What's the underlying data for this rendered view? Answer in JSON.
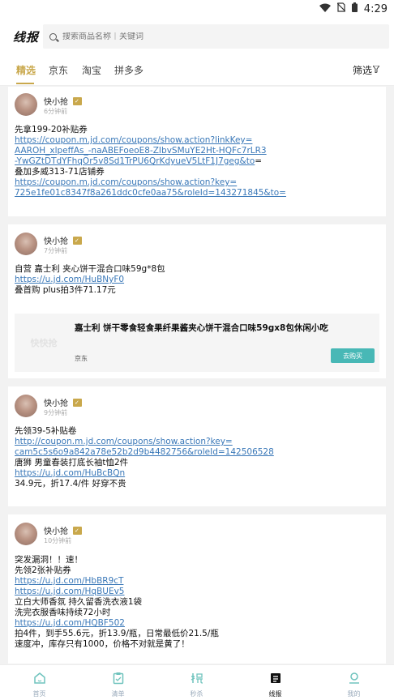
{
  "status": {
    "time": "4:29"
  },
  "header": {
    "logo": "线报",
    "search_placeholder": "搜索商品名称｜关键词"
  },
  "tabs": [
    {
      "label": "精选",
      "active": true
    },
    {
      "label": "京东",
      "active": false
    },
    {
      "label": "淘宝",
      "active": false
    },
    {
      "label": "拼多多",
      "active": false
    }
  ],
  "filter": {
    "label": "筛选"
  },
  "posts": [
    {
      "author": "快小抢",
      "time": "6分钟前",
      "lines": [
        {
          "text": "先拿199-20补贴券",
          "link": false
        },
        {
          "text": "https://coupon.m.jd.com/coupons/show.action?linkKey=",
          "link": true
        },
        {
          "text": "AAROH_xlpeffAs_-naABEFoeoE8-ZIbvSMuYE2Ht-HQFc7rLR3",
          "link": true
        },
        {
          "text": "-YwGZtDTdYFhqOr5v8Sd1TrPU6QrKdyueV5LtF1J7geg&to",
          "link": true,
          "suffix": "="
        },
        {
          "text": "叠加多威313-71店铺券",
          "link": false
        },
        {
          "text": "https://coupon.m.jd.com/coupons/show.action?key=",
          "link": true
        },
        {
          "text": "725e1fe01c8347f8a261ddc0cfe0aa75&roleId=143271845&to=",
          "link": true
        }
      ]
    },
    {
      "author": "快小抢",
      "time": "7分钟前",
      "lines": [
        {
          "text": "自营 嘉士利  夹心饼干混合口味59g*8包",
          "link": false
        },
        {
          "text": "https://u.jd.com/HuBNyF0",
          "link": true
        },
        {
          "text": "叠首购 plus拍3件71.17元",
          "link": false
        }
      ],
      "product": {
        "thumb_text": "快快抢",
        "title": "嘉士利  饼干零食轻食果纤果酱夹心饼干混合口味59gx8包休闲小吃",
        "platform": "京东",
        "button": "去购买"
      }
    },
    {
      "author": "快小抢",
      "time": "9分钟前",
      "lines": [
        {
          "text": "先领39-5补贴卷",
          "link": false
        },
        {
          "text": "http://coupon.m.jd.com/coupons/show.action?key=",
          "link": true
        },
        {
          "text": "cam5c5s6o9a842a78e52b2d9b4482756&roleId=142506528",
          "link": true
        },
        {
          "text": "唐狮 男童春装打底长袖t恤2件",
          "link": false
        },
        {
          "text": "https://u.jd.com/HuBcBQn",
          "link": true
        },
        {
          "text": "34.9元，折17.4/件 好穿不贵",
          "link": false
        }
      ]
    },
    {
      "author": "快小抢",
      "time": "10分钟前",
      "lines": [
        {
          "text": "突发漏洞！！速！",
          "link": false
        },
        {
          "text": "先领2张补贴券",
          "link": false
        },
        {
          "text": "https://u.jd.com/HbBR9cT",
          "link": true
        },
        {
          "text": "https://u.jd.com/HqBUEv5",
          "link": true
        },
        {
          "text": "立白大师香氛 持久留香洗衣液1袋",
          "link": false
        },
        {
          "text": "洗完衣服香味持续72小时",
          "link": false
        },
        {
          "text": "https://u.jd.com/HQBF502",
          "link": true
        },
        {
          "text": "拍4件，到手55.6元，折13.9/瓶，日常最低价21.5/瓶",
          "link": false
        },
        {
          "text": "速度冲，库存只有1000，价格不对就是黄了！",
          "link": false
        }
      ]
    }
  ],
  "bottom_nav": [
    {
      "label": "首页",
      "icon": "home-icon",
      "active": false
    },
    {
      "label": "清单",
      "icon": "clipboard-icon",
      "active": false
    },
    {
      "label": "秒杀",
      "icon": "grab-icon",
      "active": false
    },
    {
      "label": "线报",
      "icon": "news-icon",
      "active": true
    },
    {
      "label": "我的",
      "icon": "profile-icon",
      "active": false
    }
  ],
  "colors": {
    "accent": "#c9a84c",
    "link": "#3a78b8",
    "buy": "#48b8b6"
  }
}
